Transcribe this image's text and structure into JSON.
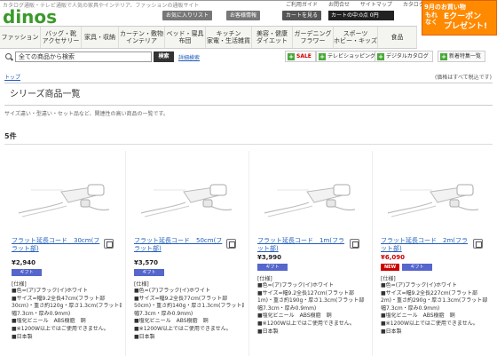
{
  "header": {
    "tagline": "カタログ通販・テレビ通販で人気の家具やインテリア、ファッションの通販サイト",
    "links": [
      "ご利用ガイド",
      "お問合せ",
      "サイトマップ",
      "カタログ一覧"
    ],
    "logo": "dinos",
    "favorites_label": "お気に入りリスト",
    "recent_label": "お客様情報",
    "cart_label": "カートを見る",
    "cart_text": "カートの中:0点 0円"
  },
  "promo": {
    "line1": "9月のお買い物",
    "line2": "もれなく",
    "line3": "Eクーポン\nプレゼント!"
  },
  "nav": {
    "items": [
      "ファッション",
      "バッグ・靴\nアクセサリー",
      "家具・収納",
      "カーテン・敷物\nインテリア",
      "ベッド・寝具\n布団",
      "キッチン\n家電・生活雑貨",
      "美容・健康\nダイエット",
      "ガーデニング\nフラワー",
      "スポーツ\nホビー・キッズ",
      "食品"
    ]
  },
  "search": {
    "value": "全ての商品から検索",
    "button": "検索",
    "advanced": "詳細検索"
  },
  "shortcuts": [
    "SALE",
    "テレビショッピング",
    "デジタルカタログ",
    "新着特集一覧"
  ],
  "breadcrumb": "トップ",
  "tax_note": "(価格はすべて税込です)",
  "page_title": "シリーズ商品一覧",
  "subtitle": "サイズ違い・型違い・セット品など、関連性の高い商品の一覧です。",
  "result_count": "5件",
  "spec_label": "[仕様]",
  "gift_label": "ギフト",
  "products": [
    {
      "name": "フラット延長コード　30cm(フラット部)",
      "price": "¥2,940",
      "new": "",
      "specs": [
        "■色=(ア)ブラック(イ)ホワイト",
        "■サイズ=幅9.2全長47cm(フラット部",
        "30cm)・重さ約120g・厚さ1.3cm(フラット部",
        "幅7.3cm・厚み0.9mm)",
        "■塩化ビニール　ABS樹脂　銅",
        "■※1200W以上ではご使用できません。",
        "■日本製"
      ]
    },
    {
      "name": "フラット延長コード　50cm(フラット部)",
      "price": "¥3,570",
      "new": "",
      "specs": [
        "■色=(ア)ブラック(イ)ホワイト",
        "■サイズ=幅9.2全長77cm(フラット部",
        "50cm)・重さ約140g・厚さ1.3cm(フラット部",
        "幅7.3cm・厚み0.9mm)",
        "■塩化ビニール　ABS樹脂　銅",
        "■※1200W以上ではご使用できません。",
        "■日本製"
      ]
    },
    {
      "name": "フラット延長コード　1m(フラット部)",
      "price": "¥3,990",
      "new": "",
      "specs": [
        "■色=(ア)ブラック(イ)ホワイト",
        "■サイズ=幅9.2全長127cm(フラット部",
        "1m)・重さ約190g・厚さ1.3cm(フラット部",
        "幅7.3cm・厚み0.9mm)",
        "■塩化ビニール　ABS樹脂　銅",
        "■※1200W以上ではご使用できません。",
        "■日本製"
      ]
    },
    {
      "name": "フラット延長コード　2m(フラット部)",
      "price": "¥6,090",
      "new": "NEW",
      "specs": [
        "■色=(ア)ブラック(イ)ホワイト",
        "■サイズ=幅9.2全長227cm(フラット部",
        "2m)・重さ約290g・厚さ1.3cm(フラット部",
        "幅7.3cm・厚み0.9mm)",
        "■塩化ビニール　ABS樹脂　銅",
        "■※1200W以上ではご使用できません。",
        "■日本製"
      ]
    }
  ],
  "colors": {
    "brand": "#3a9a2a",
    "link": "#225ebb",
    "promo": "#ff8a00",
    "gift": "#5566cc",
    "new": "#cc0000"
  }
}
